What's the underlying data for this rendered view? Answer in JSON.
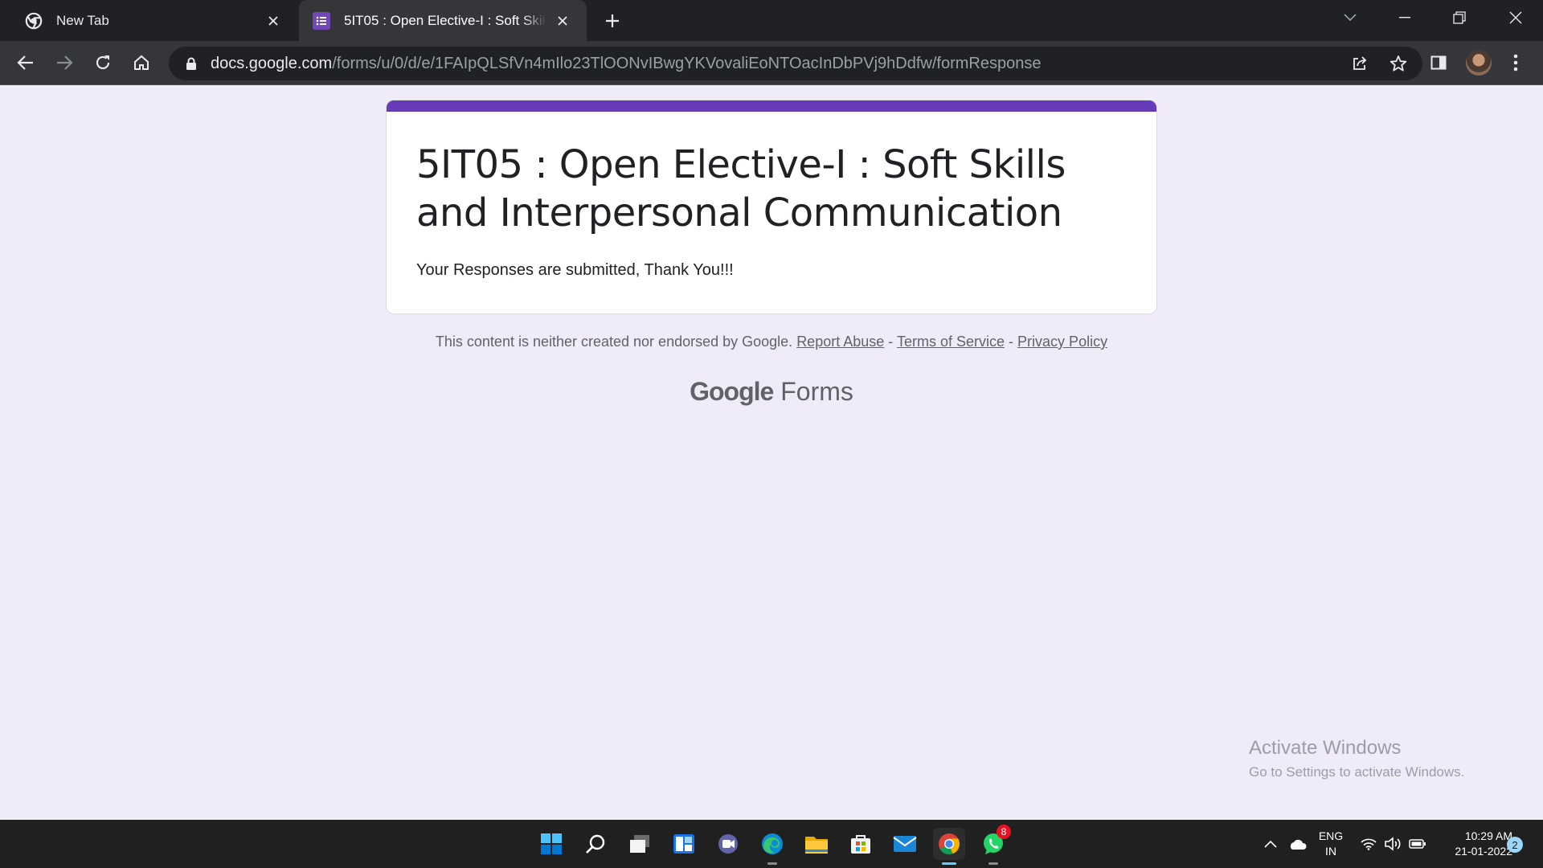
{
  "browser": {
    "tabs": [
      {
        "title": "New Tab",
        "icon": "chrome-icon",
        "active": false
      },
      {
        "title": "5IT05 : Open Elective-I : Soft Skills and Interpersonal Communication",
        "icon": "google-forms-icon",
        "active": true
      }
    ],
    "url": {
      "host": "docs.google.com",
      "path": "/forms/u/0/d/e/1FAIpQLSfVn4mIlo23TlOONvIBwgYKVovaliEoNTOacInDbPVj9hDdfw/formResponse"
    }
  },
  "form": {
    "accent_color": "#673ab7",
    "title": "5IT05 : Open Elective-I : Soft Skills and Interpersonal Communication",
    "confirmation": "Your Responses are submitted, Thank You!!!"
  },
  "footer": {
    "disclaimer": "This content is neither created nor endorsed by Google.",
    "report_abuse": "Report Abuse",
    "separator": "-",
    "terms": "Terms of Service",
    "privacy": "Privacy Policy",
    "brand_google": "Google",
    "brand_forms": "Forms"
  },
  "watermark": {
    "line1": "Activate Windows",
    "line2": "Go to Settings to activate Windows."
  },
  "taskbar": {
    "apps": [
      "start-icon",
      "search-icon",
      "task-view-icon",
      "widgets-icon",
      "teams-chat-icon",
      "edge-icon",
      "file-explorer-icon",
      "store-icon",
      "mail-icon",
      "chrome-icon",
      "whatsapp-icon"
    ],
    "whatsapp_badge": "8",
    "language": "ENG",
    "region": "IN",
    "time": "10:29 AM",
    "date": "21-01-2022",
    "notifications": "2"
  }
}
